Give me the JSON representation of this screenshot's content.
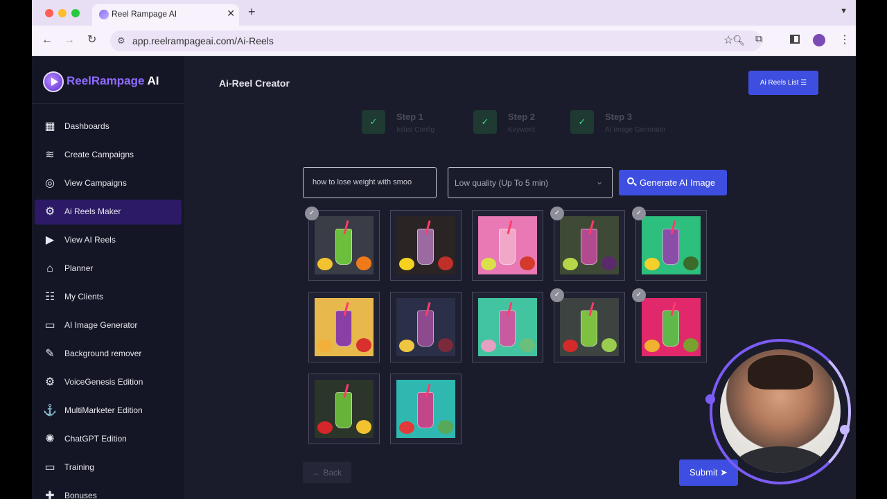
{
  "browser": {
    "tab_title": "Reel Rampage AI",
    "url": "app.reelrampageai.com/Ai-Reels"
  },
  "sidebar": {
    "logo_part1": "ReelRampage",
    "logo_part2": "AI",
    "items": [
      {
        "label": "Dashboards",
        "icon": "dashboard-icon",
        "active": false
      },
      {
        "label": "Create Campaigns",
        "icon": "layers-icon",
        "active": false
      },
      {
        "label": "View Campaigns",
        "icon": "users-circle-icon",
        "active": false
      },
      {
        "label": "Ai Reels Maker",
        "icon": "ai-gear-icon",
        "active": true
      },
      {
        "label": "View AI Reels",
        "icon": "video-play-icon",
        "active": false
      },
      {
        "label": "Planner",
        "icon": "bank-icon",
        "active": false
      },
      {
        "label": "My Clients",
        "icon": "clients-icon",
        "active": false
      },
      {
        "label": "AI Image Generator",
        "icon": "images-icon",
        "active": false
      },
      {
        "label": "Background remover",
        "icon": "brush-icon",
        "active": false
      },
      {
        "label": "VoiceGenesis Edition",
        "icon": "voice-gear-icon",
        "active": false
      },
      {
        "label": "MultiMarketer Edition",
        "icon": "anchor-icon",
        "active": false
      },
      {
        "label": "ChatGPT Edition",
        "icon": "openai-icon",
        "active": false
      },
      {
        "label": "Training",
        "icon": "monitor-icon",
        "active": false
      },
      {
        "label": "Bonuses",
        "icon": "gift-icon",
        "active": false
      }
    ]
  },
  "main": {
    "title": "Ai-Reel Creator",
    "reels_list_label": "Ai Reels List",
    "steps": [
      {
        "title": "Step 1",
        "subtitle": "Initial Config"
      },
      {
        "title": "Step 2",
        "subtitle": "Keyword"
      },
      {
        "title": "Step 3",
        "subtitle": "AI Image Generator"
      }
    ],
    "keyword_value": "how to lose weight with smoo",
    "quality_value": "Low quality (Up To 5 min)",
    "generate_label": "Generate AI Image",
    "back_label": "← Back",
    "submit_label": "Submit ➤"
  },
  "images": [
    {
      "selected": true,
      "bg": "#3a3c46",
      "drink": "#6bbf3c",
      "f1": "#f2c230",
      "f2": "#f07a1a"
    },
    {
      "selected": false,
      "bg": "#2a2424",
      "drink": "#9b6aa0",
      "f1": "#f5d21f",
      "f2": "#c0302a"
    },
    {
      "selected": false,
      "bg": "#e879b5",
      "drink": "#f1a7c7",
      "f1": "#d9e04a",
      "f2": "#d33a2c"
    },
    {
      "selected": true,
      "bg": "#3e4a35",
      "drink": "#b24a8f",
      "f1": "#b6d64a",
      "f2": "#5a2a6b"
    },
    {
      "selected": true,
      "bg": "#2dbf7e",
      "drink": "#8a4da8",
      "f1": "#f3d02a",
      "f2": "#3a6b2a"
    },
    {
      "selected": false,
      "bg": "#e7b84b",
      "drink": "#8a3fa6",
      "f1": "#f2b03a",
      "f2": "#d8302c"
    },
    {
      "selected": false,
      "bg": "#2b3048",
      "drink": "#8e4a8f",
      "f1": "#f0c640",
      "f2": "#7a2a3a"
    },
    {
      "selected": false,
      "bg": "#43c4a0",
      "drink": "#c95aa0",
      "f1": "#e6a0c0",
      "f2": "#6ac07a"
    },
    {
      "selected": true,
      "bg": "#3c4340",
      "drink": "#7ec040",
      "f1": "#d42a2a",
      "f2": "#9acc50"
    },
    {
      "selected": true,
      "bg": "#e0286a",
      "drink": "#5fb84a",
      "f1": "#f0b030",
      "f2": "#7aa030"
    },
    {
      "selected": false,
      "bg": "#2b352a",
      "drink": "#67b33a",
      "f1": "#d7262a",
      "f2": "#f2c230"
    },
    {
      "selected": false,
      "bg": "#2fb8b0",
      "drink": "#c2478a",
      "f1": "#e23a3a",
      "f2": "#58a85a"
    }
  ]
}
